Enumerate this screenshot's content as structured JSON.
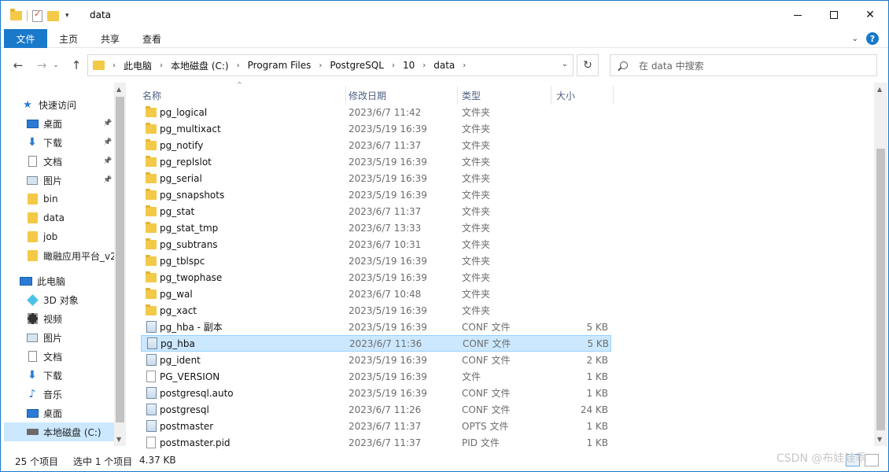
{
  "window": {
    "title": "data",
    "colors": {
      "accent": "#1979ca",
      "selection": "#cce8ff",
      "folder": "#f3c948"
    }
  },
  "ribbon": {
    "file_tab": "文件",
    "tabs": [
      "主页",
      "共享",
      "查看"
    ],
    "help": "?"
  },
  "address": {
    "breadcrumbs": [
      "此电脑",
      "本地磁盘 (C:)",
      "Program Files",
      "PostgreSQL",
      "10",
      "data"
    ]
  },
  "search": {
    "placeholder": "在 data 中搜索"
  },
  "sidebar": {
    "items": [
      {
        "label": "快速访问",
        "icon": "star-icon",
        "pinned": false
      },
      {
        "label": "桌面",
        "icon": "desktop-icon",
        "pinned": true
      },
      {
        "label": "下载",
        "icon": "download-icon",
        "pinned": true
      },
      {
        "label": "文档",
        "icon": "document-icon",
        "pinned": true
      },
      {
        "label": "图片",
        "icon": "picture-icon",
        "pinned": true
      },
      {
        "label": "bin",
        "icon": "folder-icon",
        "pinned": false
      },
      {
        "label": "data",
        "icon": "folder-icon",
        "pinned": false
      },
      {
        "label": "job",
        "icon": "folder-icon",
        "pinned": false
      },
      {
        "label": "瞰融应用平台_v2",
        "icon": "folder-icon",
        "pinned": false
      },
      {
        "label": "此电脑",
        "icon": "computer-icon",
        "pinned": false
      },
      {
        "label": "3D 对象",
        "icon": "3d-objects-icon",
        "pinned": false
      },
      {
        "label": "视频",
        "icon": "video-icon",
        "pinned": false
      },
      {
        "label": "图片",
        "icon": "picture-icon",
        "pinned": false
      },
      {
        "label": "文档",
        "icon": "document-icon",
        "pinned": false
      },
      {
        "label": "下载",
        "icon": "download-icon",
        "pinned": false
      },
      {
        "label": "音乐",
        "icon": "music-icon",
        "pinned": false
      },
      {
        "label": "桌面",
        "icon": "desktop-icon",
        "pinned": false
      },
      {
        "label": "本地磁盘 (C:)",
        "icon": "drive-icon",
        "pinned": false,
        "selected": true
      }
    ]
  },
  "columns": {
    "name": "名称",
    "date": "修改日期",
    "type": "类型",
    "size": "大小"
  },
  "files": [
    {
      "name": "pg_logical",
      "date": "2023/6/7 11:42",
      "type": "文件夹",
      "size": "",
      "kind": "folder"
    },
    {
      "name": "pg_multixact",
      "date": "2023/5/19 16:39",
      "type": "文件夹",
      "size": "",
      "kind": "folder"
    },
    {
      "name": "pg_notify",
      "date": "2023/6/7 11:37",
      "type": "文件夹",
      "size": "",
      "kind": "folder"
    },
    {
      "name": "pg_replslot",
      "date": "2023/5/19 16:39",
      "type": "文件夹",
      "size": "",
      "kind": "folder"
    },
    {
      "name": "pg_serial",
      "date": "2023/5/19 16:39",
      "type": "文件夹",
      "size": "",
      "kind": "folder"
    },
    {
      "name": "pg_snapshots",
      "date": "2023/5/19 16:39",
      "type": "文件夹",
      "size": "",
      "kind": "folder"
    },
    {
      "name": "pg_stat",
      "date": "2023/6/7 11:37",
      "type": "文件夹",
      "size": "",
      "kind": "folder"
    },
    {
      "name": "pg_stat_tmp",
      "date": "2023/6/7 13:33",
      "type": "文件夹",
      "size": "",
      "kind": "folder"
    },
    {
      "name": "pg_subtrans",
      "date": "2023/6/7 10:31",
      "type": "文件夹",
      "size": "",
      "kind": "folder"
    },
    {
      "name": "pg_tblspc",
      "date": "2023/5/19 16:39",
      "type": "文件夹",
      "size": "",
      "kind": "folder"
    },
    {
      "name": "pg_twophase",
      "date": "2023/5/19 16:39",
      "type": "文件夹",
      "size": "",
      "kind": "folder"
    },
    {
      "name": "pg_wal",
      "date": "2023/6/7 10:48",
      "type": "文件夹",
      "size": "",
      "kind": "folder"
    },
    {
      "name": "pg_xact",
      "date": "2023/5/19 16:39",
      "type": "文件夹",
      "size": "",
      "kind": "folder"
    },
    {
      "name": "pg_hba - 副本",
      "date": "2023/5/19 16:39",
      "type": "CONF 文件",
      "size": "5 KB",
      "kind": "conf"
    },
    {
      "name": "pg_hba",
      "date": "2023/6/7 11:36",
      "type": "CONF 文件",
      "size": "5 KB",
      "kind": "conf",
      "selected": true
    },
    {
      "name": "pg_ident",
      "date": "2023/5/19 16:39",
      "type": "CONF 文件",
      "size": "2 KB",
      "kind": "conf"
    },
    {
      "name": "PG_VERSION",
      "date": "2023/5/19 16:39",
      "type": "文件",
      "size": "1 KB",
      "kind": "file"
    },
    {
      "name": "postgresql.auto",
      "date": "2023/5/19 16:39",
      "type": "CONF 文件",
      "size": "1 KB",
      "kind": "conf"
    },
    {
      "name": "postgresql",
      "date": "2023/6/7 11:26",
      "type": "CONF 文件",
      "size": "24 KB",
      "kind": "conf"
    },
    {
      "name": "postmaster",
      "date": "2023/6/7 11:37",
      "type": "OPTS 文件",
      "size": "1 KB",
      "kind": "conf"
    },
    {
      "name": "postmaster.pid",
      "date": "2023/6/7 11:37",
      "type": "PID 文件",
      "size": "1 KB",
      "kind": "file"
    }
  ],
  "status": {
    "count": "25 个项目",
    "selected": "选中 1 个项目",
    "size": "4.37 KB"
  },
  "watermark": "CSDN @布娃娃乖"
}
